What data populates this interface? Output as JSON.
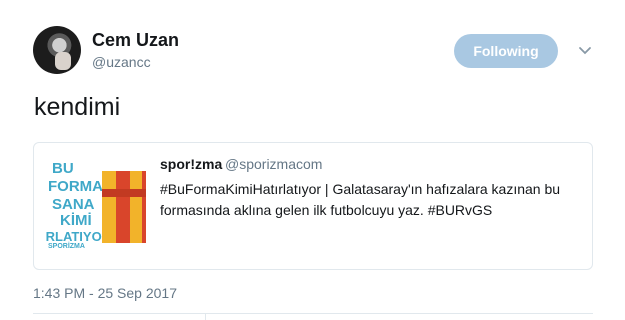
{
  "author": {
    "display_name": "Cem Uzan",
    "handle": "@uzancc",
    "avatar_icon": "profile-photo"
  },
  "follow_button": {
    "label": "Following",
    "color": "#a9c8e2"
  },
  "menu_icon": "chevron-down-icon",
  "tweet": {
    "text": "kendimi"
  },
  "quoted_tweet": {
    "author_name": "spor!zma",
    "author_handle": "@sporizmacom",
    "text": "#BuFormaKimiHatırlatıyor | Galatasaray'ın hafızalara kazınan bu formasında aklına gelen ilk futbolcuyu yaz. #BURvGS",
    "image": {
      "lines": [
        "BU",
        "FORMA",
        "SANA",
        "KİMİ",
        "IRLATIYOR"
      ],
      "brand": "SPORİZMA"
    }
  },
  "timestamp": "1:43 PM - 25 Sep 2017"
}
